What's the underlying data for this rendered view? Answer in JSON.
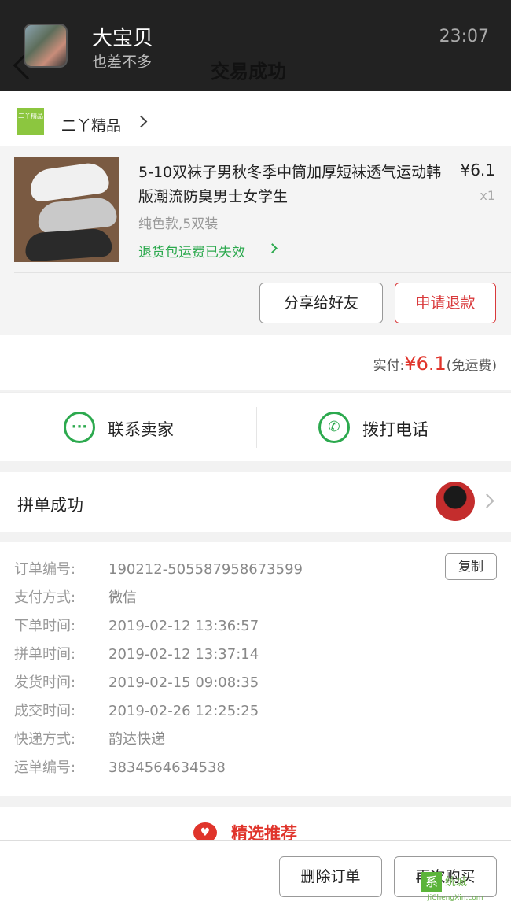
{
  "header": {
    "nickname": "大宝贝",
    "subtitle": "也差不多",
    "status": "交易成功",
    "time": "23:07"
  },
  "shop": {
    "logo_text": "二丫精品",
    "name": "二丫精品"
  },
  "product": {
    "title": "5-10双袜子男秋冬季中筒加厚短袜透气运动韩版潮流防臭男士女学生",
    "price": "¥6.1",
    "quantity": "x1",
    "spec": "纯色款,5双装",
    "shipping_note": "退货包运费已失效"
  },
  "actions": {
    "share": "分享给好友",
    "refund": "申请退款"
  },
  "payment": {
    "label": "实付:",
    "amount": "¥6.1",
    "note": "(免运费)"
  },
  "contact": {
    "seller": "联系卖家",
    "call": "拨打电话"
  },
  "group": {
    "label": "拼单成功"
  },
  "details": {
    "copy_label": "复制",
    "rows": [
      {
        "key": "订单编号:",
        "value": "190212-505587958673599"
      },
      {
        "key": "支付方式:",
        "value": "微信"
      },
      {
        "key": "下单时间:",
        "value": "2019-02-12 13:36:57"
      },
      {
        "key": "拼单时间:",
        "value": "2019-02-12 13:37:14"
      },
      {
        "key": "发货时间:",
        "value": "2019-02-15 09:08:35"
      },
      {
        "key": "成交时间:",
        "value": "2019-02-26 12:25:25"
      },
      {
        "key": "快递方式:",
        "value": "韵达快递"
      },
      {
        "key": "运单编号:",
        "value": "3834564634538"
      }
    ]
  },
  "recommend": {
    "label": "精选推荐"
  },
  "bottom": {
    "delete": "删除订单",
    "rebuy": "再次购买"
  },
  "watermark": {
    "box": "系",
    "text": "统城",
    "url": "JiChengXin.com"
  },
  "colors": {
    "accent_red": "#e0342b",
    "accent_green": "#2ca94e",
    "header_bg": "#222222"
  }
}
